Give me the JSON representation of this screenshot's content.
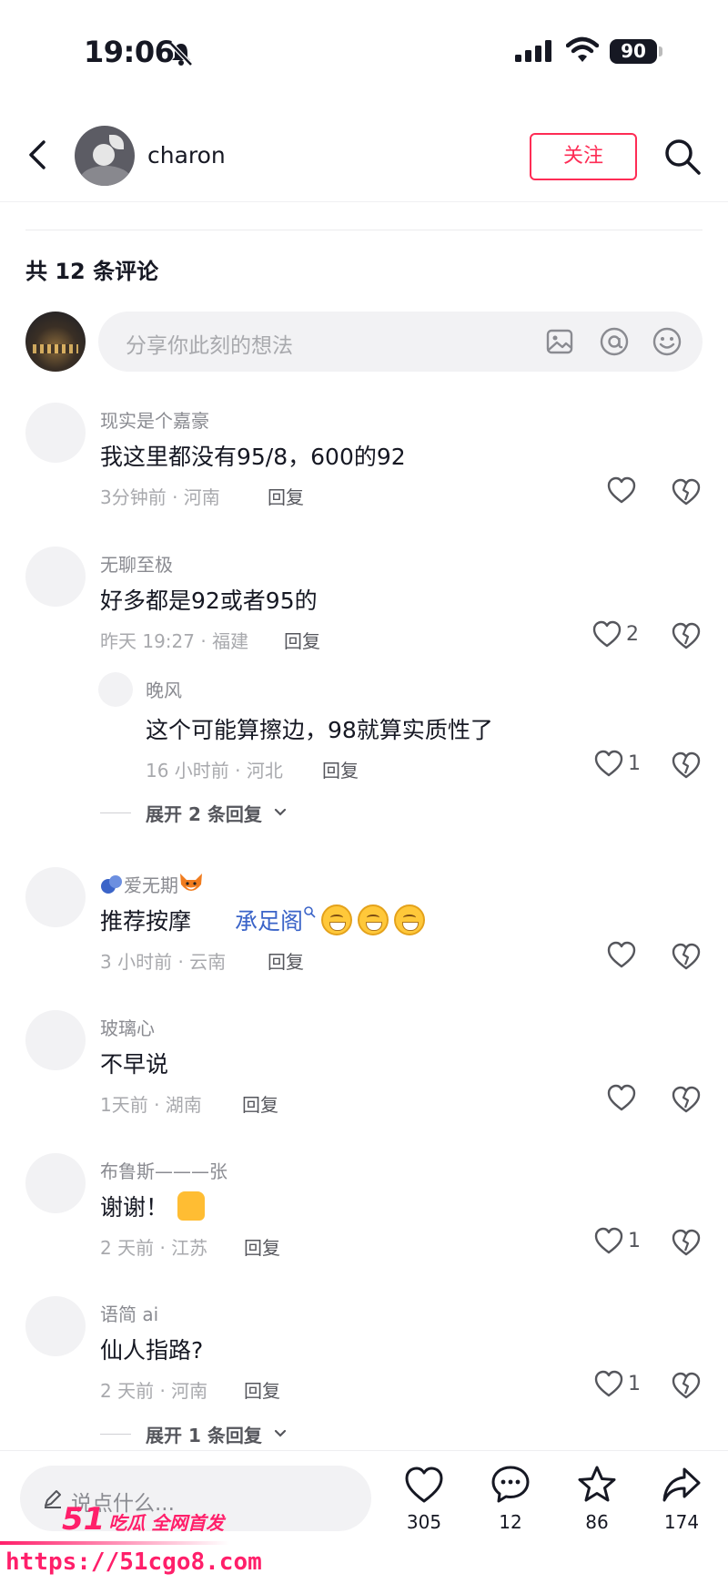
{
  "status_bar": {
    "time": "19:06",
    "battery": "90"
  },
  "header": {
    "username": "charon",
    "follow_label": "关注"
  },
  "comments_count_label": "共 12 条评论",
  "compose": {
    "placeholder": "分享你此刻的想法"
  },
  "comments": [
    {
      "author": "现实是个嘉豪",
      "text": "我这里都没有95/8，600的92",
      "meta": "3分钟前 · 河南",
      "reply": "回复",
      "likes": ""
    },
    {
      "author": "无聊至极",
      "text": "好多都是92或者95的",
      "meta": "昨天 19:27 · 福建",
      "reply": "回复",
      "likes": "2",
      "replies": [
        {
          "author": "晚风",
          "text": "这个可能算擦边，98就算实质性了",
          "meta": "16 小时前 · 河北",
          "reply": "回复",
          "likes": "1"
        }
      ],
      "expand_label": "展开 2 条回复"
    },
    {
      "author": "爱无期",
      "text": "推荐按摩",
      "link_text": "承足阁",
      "meta": "3 小时前 · 云南",
      "reply": "回复",
      "likes": ""
    },
    {
      "author": "玻璃心",
      "text": "不早说",
      "meta": "1天前 · 湖南",
      "reply": "回复",
      "likes": ""
    },
    {
      "author": "布鲁斯———张",
      "text": "谢谢！",
      "meta": "2 天前 · 江苏",
      "reply": "回复",
      "likes": "1"
    },
    {
      "author": "语简 ai",
      "text": "仙人指路?",
      "meta": "2 天前 · 河南",
      "reply": "回复",
      "likes": "1",
      "expand_label": "展开 1 条回复"
    }
  ],
  "bottom_bar": {
    "placeholder": "说点什么...",
    "like_count": "305",
    "comment_count": "12",
    "favorite_count": "86",
    "share_count": "174"
  },
  "watermark": {
    "logo": "51",
    "logo_sub": "吃瓜 全网首发",
    "url": "https://51cgo8.com"
  },
  "colors": {
    "accent": "#fe2c55",
    "link": "#3b64c8",
    "watermark": "#ff1f6a"
  }
}
